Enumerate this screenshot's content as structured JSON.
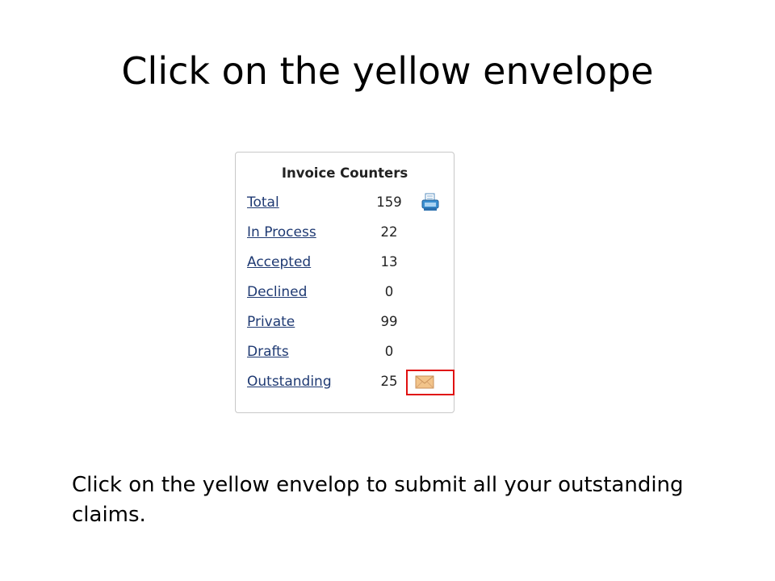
{
  "slide": {
    "title": "Click on the yellow envelope",
    "caption": "Click on the yellow envelop to submit all your outstanding claims."
  },
  "panel": {
    "title": "Invoice Counters",
    "rows": [
      {
        "label": "Total",
        "count": "159",
        "icon": "printer-icon"
      },
      {
        "label": "In Process",
        "count": "22"
      },
      {
        "label": "Accepted",
        "count": "13"
      },
      {
        "label": "Declined",
        "count": "0"
      },
      {
        "label": "Private",
        "count": "99"
      },
      {
        "label": "Drafts",
        "count": "0"
      },
      {
        "label": "Outstanding",
        "count": "25",
        "icon": "yellow-envelope-icon"
      }
    ]
  },
  "colors": {
    "link": "#1f3a73",
    "highlight": "#e01010",
    "envelope": "#f2c48a",
    "printer": "#3a8fd0"
  }
}
